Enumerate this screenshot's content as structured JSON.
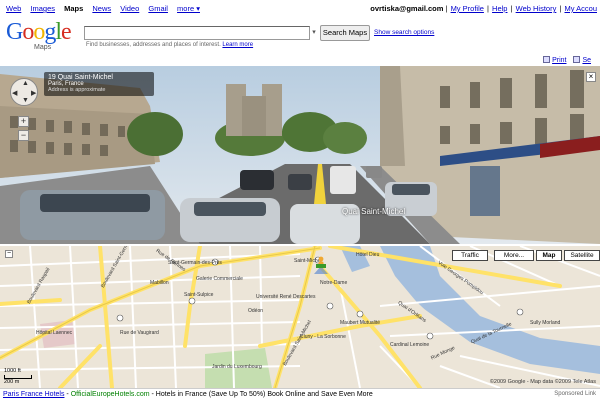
{
  "topnav": {
    "links": [
      "Web",
      "Images",
      "Maps",
      "News",
      "Video",
      "Gmail",
      "more ▾"
    ],
    "active": "Maps",
    "email": "ovrtiska@gmail.com",
    "sep": "|",
    "account_links": [
      "My Profile",
      "Help",
      "Web History",
      "My Accou"
    ]
  },
  "header": {
    "logo_text": "Google",
    "logo_sub": "Maps",
    "search_value": "",
    "search_placeholder": "",
    "search_button": "Search Maps",
    "show_options": "Show search options",
    "hint": "Find businesses, addresses and places of interest.",
    "hint_link": "Learn more",
    "dropdown_glyph": "▾"
  },
  "actionbar": {
    "print": "Print",
    "send": "Se"
  },
  "streetview": {
    "street": "19 Quai Saint-Michel",
    "city": "Paris, France",
    "note": "Address is approximate",
    "street_label": "Quai Saint-Michel",
    "nav_up": "▲",
    "nav_down": "▼",
    "nav_left": "◀",
    "nav_right": "▶",
    "zoom_in": "+",
    "zoom_out": "−",
    "close": "×"
  },
  "map": {
    "buttons": {
      "traffic": "Traffic",
      "more": "More...",
      "map": "Map",
      "satellite": "Satellite"
    },
    "selected": "Map",
    "scale_label": "1000 ft",
    "scale_label2": "200 m",
    "copyright": "©2009 Google - Map data ©2009 Tele Atlas",
    "zoom": "−",
    "labels": {
      "l1": "Boulevard Saint-Germain",
      "l2": "Rue de Rennes",
      "l3": "Saint-Sulpice",
      "l4": "Odéon",
      "l5": "Saint-Michel",
      "l6": "Hôtel Dieu",
      "l7": "Boulevard Saint-Michel",
      "l8": "Quai d'Orléans",
      "l9": "Hôpital Laennec",
      "l10": "Jardin du Luxembourg",
      "l11": "Sully Morland",
      "l12": "Rue Monge",
      "l13": "Quai de la Tournelle",
      "l14": "Notre-Dame",
      "l15": "Mabillon",
      "l16": "Maubert Mutualité",
      "l17": "Cardinal Lemoine",
      "l18": "Voie Georges Pompidou",
      "l19": "Rue de Vaugirard",
      "l20": "Boulevard Raspail",
      "l21": "Saint-Germain-des-Prés",
      "l22": "Cluny - La Sorbonne",
      "l23": "Galerie Commerciale",
      "l24": "Université René Descartes"
    }
  },
  "ad": {
    "headline": "Paris France Hotels",
    "dash": " - ",
    "url": "OfficialEuropeHotels.com",
    "text": " - Hotels in France (Save Up To 50%) Book Online and Save Even More",
    "sponsored": "Sponsored Link"
  },
  "colors": {
    "link": "#0000cc",
    "road_major": "#ffe268",
    "road_minor": "#ffffff",
    "water": "#a5bfdd",
    "park": "#c5deb0",
    "map_bg": "#ece5d8",
    "ad_url": "#008000"
  }
}
